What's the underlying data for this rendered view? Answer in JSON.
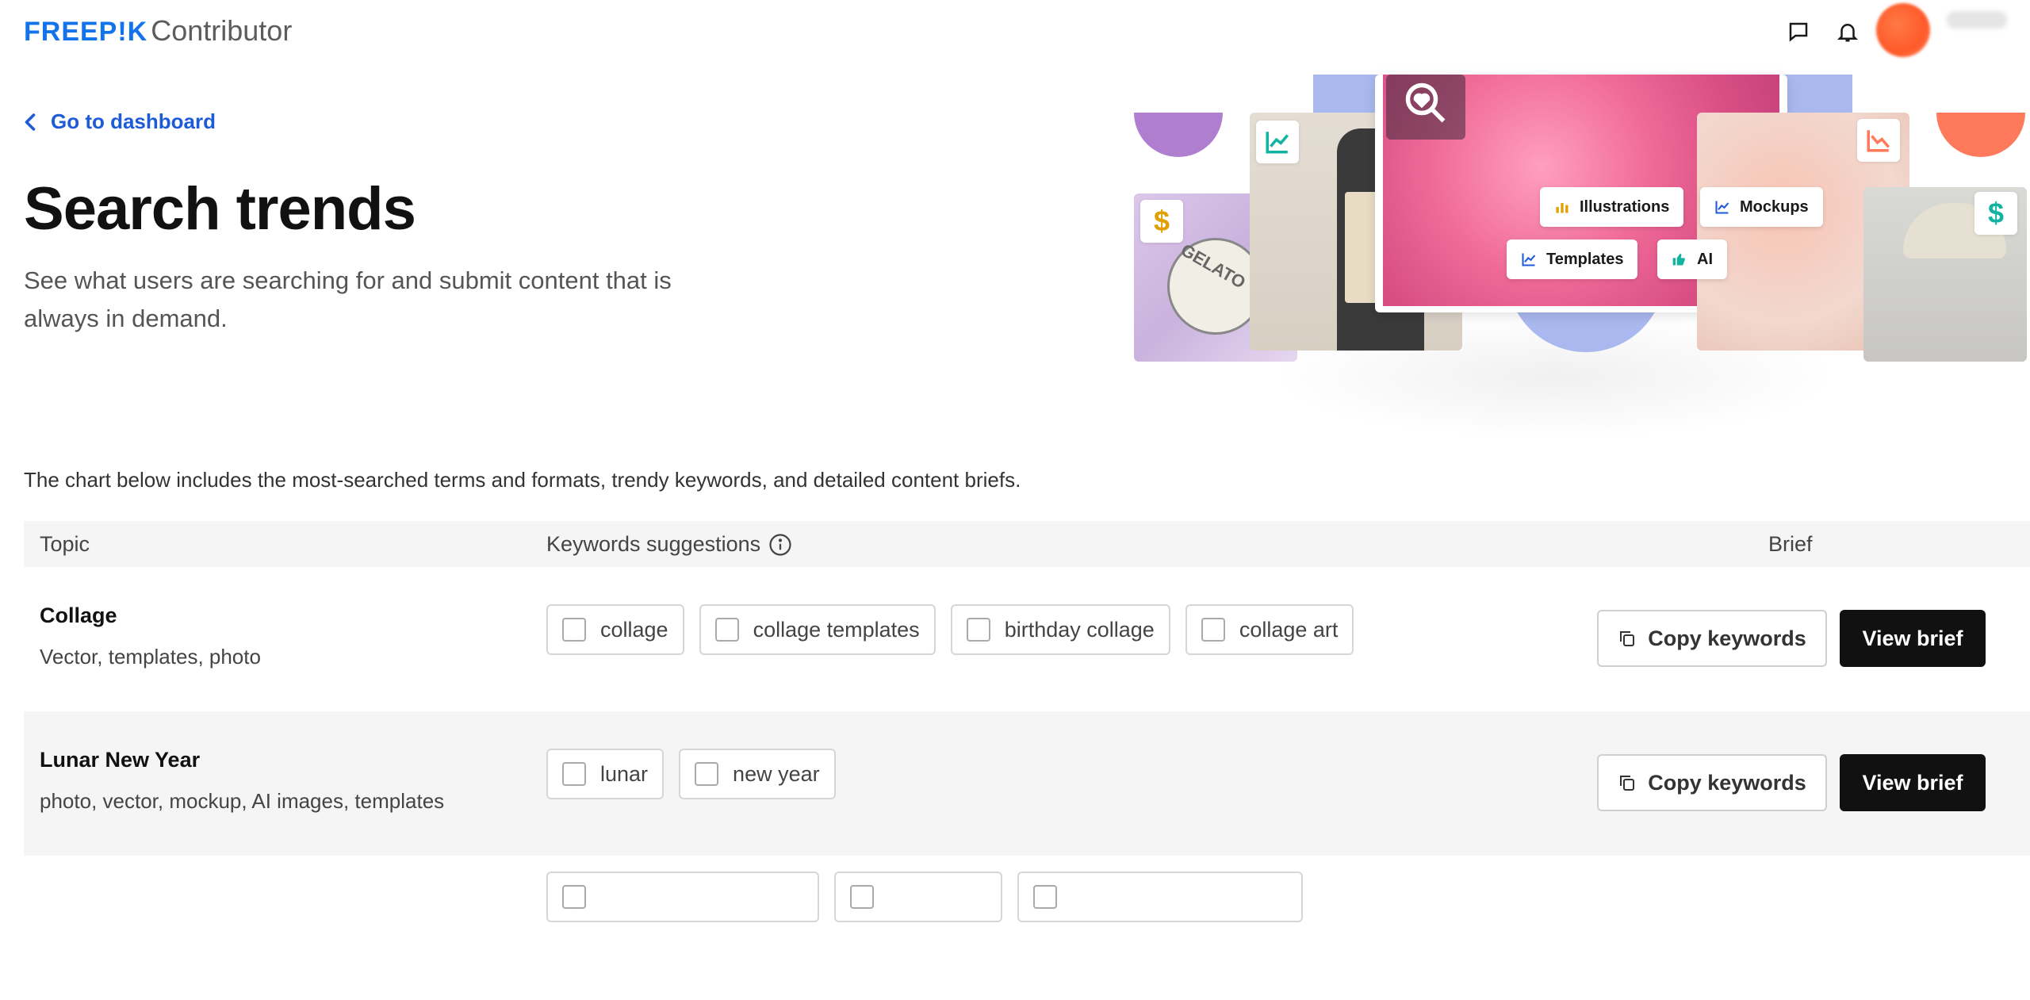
{
  "header": {
    "brand": "FREEP!K",
    "product": "Contributor",
    "icons": [
      "chat-icon",
      "bell-icon"
    ]
  },
  "nav": {
    "back_label": "Go to dashboard"
  },
  "page": {
    "title": "Search trends",
    "subtitle": "See what users are searching for and submit content that is always in demand."
  },
  "hero": {
    "chips": {
      "illustrations": "Illustrations",
      "mockups": "Mockups",
      "templates": "Templates",
      "ai": "AI"
    },
    "badge_text": "GELATO",
    "colors": {
      "purple": "#b07ecf",
      "coral": "#ff7a5c",
      "blue": "#a9b8ee",
      "teal": "#12b3a0",
      "gold": "#e0a000"
    }
  },
  "intro": "The chart below includes the most-searched terms and formats, trendy keywords, and detailed content briefs.",
  "table": {
    "headers": {
      "topic": "Topic",
      "keywords": "Keywords suggestions",
      "brief": "Brief"
    },
    "rows": [
      {
        "title": "Collage",
        "formats": "Vector, templates, photo",
        "keywords": [
          "collage",
          "collage templates",
          "birthday collage",
          "collage art"
        ]
      },
      {
        "title": "Lunar New Year",
        "formats": "photo, vector, mockup, AI images, templates",
        "keywords": [
          "lunar",
          "new year"
        ]
      }
    ],
    "copy_label": "Copy keywords",
    "view_label": "View brief"
  }
}
